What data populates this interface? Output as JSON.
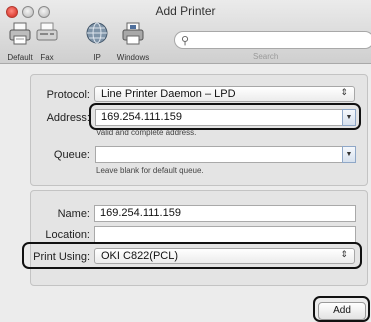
{
  "window": {
    "title": "Add Printer"
  },
  "toolbar": {
    "items": [
      {
        "label": "Default",
        "icon": "printer-icon"
      },
      {
        "label": "Fax",
        "icon": "fax-icon"
      },
      {
        "label": "IP",
        "icon": "ip-globe-icon",
        "selected": true
      },
      {
        "label": "Windows",
        "icon": "windows-printer-icon"
      }
    ],
    "search": {
      "label": "Search",
      "placeholder": ""
    }
  },
  "form": {
    "protocol": {
      "label": "Protocol:",
      "value": "Line Printer Daemon – LPD"
    },
    "address": {
      "label": "Address:",
      "value": "169.254.111.159",
      "hint": "Valid and complete address."
    },
    "queue": {
      "label": "Queue:",
      "value": "",
      "hint": "Leave blank for default queue."
    },
    "name": {
      "label": "Name:",
      "value": "169.254.111.159"
    },
    "location": {
      "label": "Location:",
      "value": ""
    },
    "print_using": {
      "label": "Print Using:",
      "value": "OKI C822(PCL)"
    }
  },
  "buttons": {
    "add": "Add"
  },
  "colors": {
    "highlight_border": "#111111",
    "window_bg": "#ececec",
    "close_red": "#e0463b"
  }
}
